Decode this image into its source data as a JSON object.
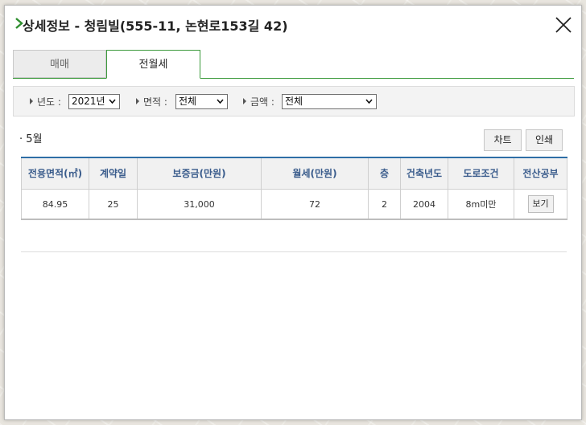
{
  "dialog": {
    "title": "상세정보 - 청림빌(555-11, 논현로153길 42)"
  },
  "tabs": [
    {
      "label": "매매",
      "active": false
    },
    {
      "label": "전월세",
      "active": true
    }
  ],
  "filters": {
    "year": {
      "label": "년도 :",
      "value": "2021년"
    },
    "area": {
      "label": "면적 :",
      "value": "전체"
    },
    "amount": {
      "label": "금액 :",
      "value": "전체"
    }
  },
  "section": {
    "month_label": "· 5월",
    "chart_button": "차트",
    "print_button": "인쇄"
  },
  "table": {
    "headers": [
      "전용면적(㎡)",
      "계약일",
      "보증금(만원)",
      "월세(만원)",
      "층",
      "건축년도",
      "도로조건",
      "전산공부"
    ],
    "rows": [
      {
        "area": "84.95",
        "day": "25",
        "deposit": "31,000",
        "rent": "72",
        "floor": "2",
        "built": "2004",
        "road": "8m미만",
        "action": "보기"
      }
    ]
  },
  "colors": {
    "accent_green": "#3c9a3c",
    "table_header_border": "#2e6ea6",
    "header_text": "#3a5c8c"
  },
  "icons": {
    "title": "chevron-right-icon",
    "close": "close-icon",
    "filter_marker": "triangle-right-icon",
    "select": "chevron-down-icon"
  }
}
